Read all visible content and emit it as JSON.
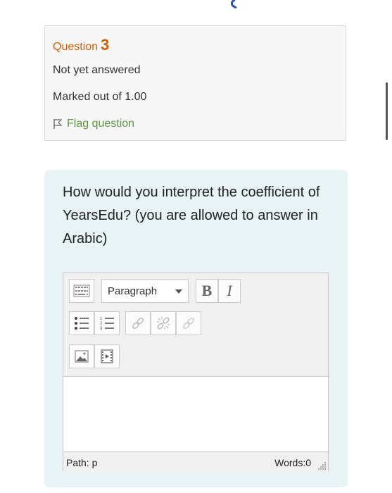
{
  "question": {
    "label": "Question",
    "number": "3",
    "state": "Not yet answered",
    "grade": "Marked out of 1.00",
    "flag_label": "Flag question",
    "text": "How would you interpret the coefficient of YearsEdu? (you are allowed to answer in Arabic)"
  },
  "editor": {
    "format_select": "Paragraph",
    "bold_label": "B",
    "italic_label": "I",
    "content": "",
    "path_label": "Path: p",
    "words_label": "Words:0"
  },
  "icons": [
    "toolbar-toggle-icon",
    "dropdown-caret-icon",
    "bullet-list-icon",
    "numbered-list-icon",
    "link-icon",
    "unlink-icon",
    "anchor-link-icon",
    "image-icon",
    "media-icon",
    "resize-handle-icon",
    "flag-icon"
  ],
  "colors": {
    "question_label": "#d35f00",
    "flag_link": "#5a9a43",
    "question_panel_bg": "#e7f3f5",
    "info_box_bg": "#f7f7f7"
  }
}
